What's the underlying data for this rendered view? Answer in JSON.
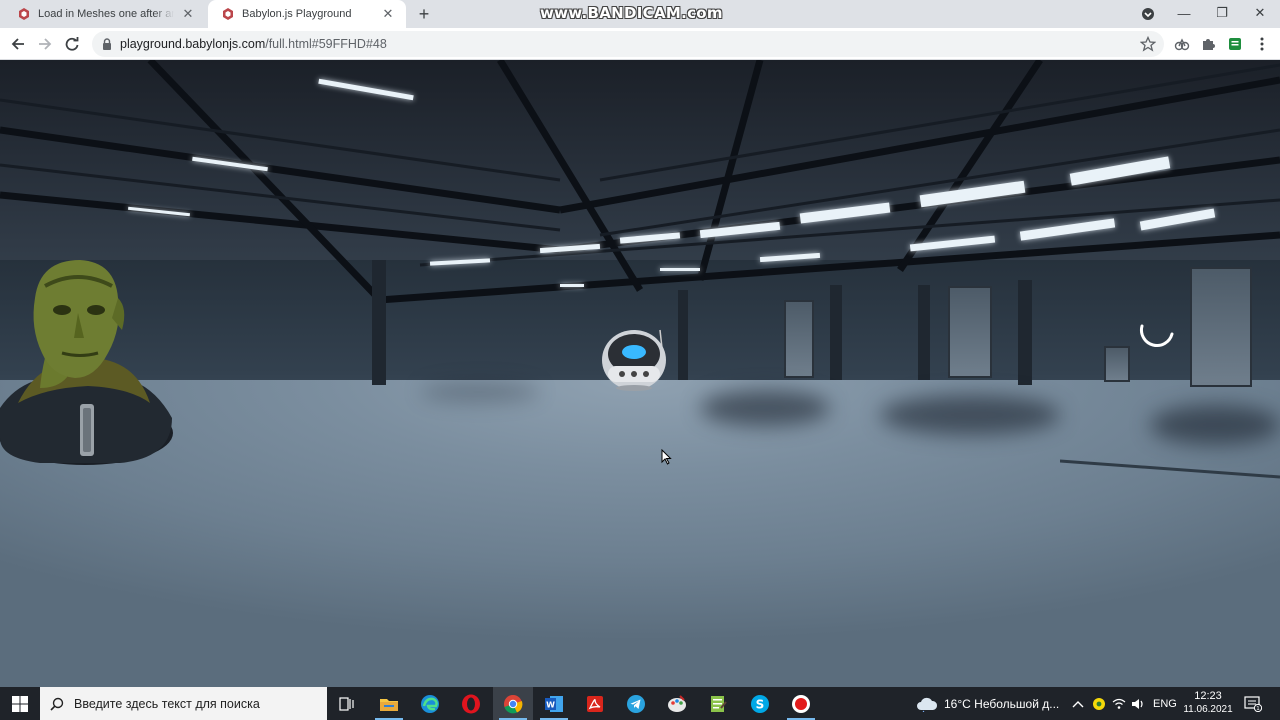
{
  "browser": {
    "tabs": [
      {
        "title": "Load in Meshes one after another",
        "active": false
      },
      {
        "title": "Babylon.js Playground",
        "active": true
      }
    ],
    "watermark": "www.BANDICAM.com",
    "url_host": "playground.babylonjs.com",
    "url_path": "/full.html#59FFHD#48",
    "window_controls": [
      "minimize-icon",
      "restore-icon",
      "close-icon"
    ]
  },
  "toolbar": {
    "icons": [
      "back-arrow-icon",
      "forward-arrow-icon",
      "reload-icon",
      "lock-icon",
      "bookmark-star-icon",
      "extension-icon",
      "puzzle-icon",
      "green-extension-icon",
      "menu-dots-icon"
    ]
  },
  "scene": {
    "description_objects": [
      "warehouse-environment",
      "alien-head-model",
      "robot-model",
      "loading-spinner",
      "mouse-cursor"
    ]
  },
  "taskbar": {
    "search_placeholder": "Введите здесь текст для поиска",
    "weather": "16°C  Небольшой д...",
    "language": "ENG",
    "time": "12:23",
    "date": "11.06.2021",
    "notification_count": "1",
    "apps": [
      "task-view-icon",
      "file-explorer-icon",
      "edge-icon",
      "opera-icon",
      "chrome-icon",
      "word-icon",
      "acrobat-icon",
      "telegram-icon",
      "paint-icon",
      "notepad-icon",
      "skype-icon",
      "bandicam-record-icon"
    ]
  },
  "colors": {
    "tabstrip": "#dee1e6",
    "taskbar": "#1f2329",
    "accent": "#76b9ed"
  }
}
